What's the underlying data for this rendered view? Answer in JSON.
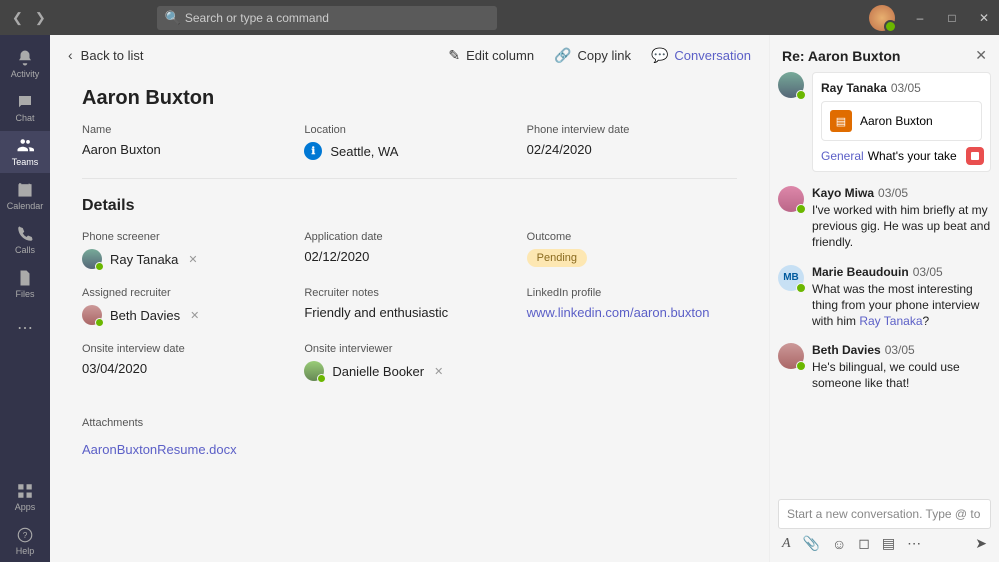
{
  "search": {
    "placeholder": "Search or type a command"
  },
  "rail": {
    "activity": "Activity",
    "chat": "Chat",
    "teams": "Teams",
    "calendar": "Calendar",
    "calls": "Calls",
    "files": "Files",
    "apps": "Apps",
    "help": "Help"
  },
  "toolbar": {
    "back": "Back to list",
    "edit": "Edit column",
    "copy": "Copy link",
    "conversation": "Conversation"
  },
  "record": {
    "title": "Aaron Buxton",
    "fields": {
      "name_l": "Name",
      "name_v": "Aaron Buxton",
      "location_l": "Location",
      "location_v": "Seattle, WA",
      "phoneDate_l": "Phone interview date",
      "phoneDate_v": "02/24/2020"
    },
    "details_h": "Details",
    "details": {
      "screener_l": "Phone screener",
      "screener_v": "Ray Tanaka",
      "appDate_l": "Application date",
      "appDate_v": "02/12/2020",
      "outcome_l": "Outcome",
      "outcome_v": "Pending",
      "recruiter_l": "Assigned recruiter",
      "recruiter_v": "Beth Davies",
      "notes_l": "Recruiter notes",
      "notes_v": "Friendly and enthusiastic",
      "linkedin_l": "LinkedIn profile",
      "linkedin_v": "www.linkedin.com/aaron.buxton",
      "onsiteDate_l": "Onsite interview date",
      "onsiteDate_v": "03/04/2020",
      "onsiteInt_l": "Onsite interviewer",
      "onsiteInt_v": "Danielle Booker"
    },
    "attachments_l": "Attachments",
    "attachment_v": "AaronBuxtonResume.docx"
  },
  "convo": {
    "title": "Re: Aaron Buxton",
    "msgs": {
      "m0_name": "Ray Tanaka",
      "m0_date": "03/05",
      "m0_card": "Aaron Buxton",
      "m0_channel": "General",
      "m0_text": "What's your take",
      "m1_name": "Kayo Miwa",
      "m1_date": "03/05",
      "m1_text": "I've worked with him briefly at my previous gig. He was up beat and friendly.",
      "m2_name": "Marie Beaudouin",
      "m2_date": "03/05",
      "m2_initials": "MB",
      "m2_text_a": "What was the most interesting thing from your phone interview with him ",
      "m2_mention": "Ray Tanaka",
      "m2_text_b": "?",
      "m3_name": "Beth Davies",
      "m3_date": "03/05",
      "m3_text": "He's bilingual, we could use someone like that!"
    },
    "compose_ph": "Start a new conversation. Type @ to m..."
  }
}
